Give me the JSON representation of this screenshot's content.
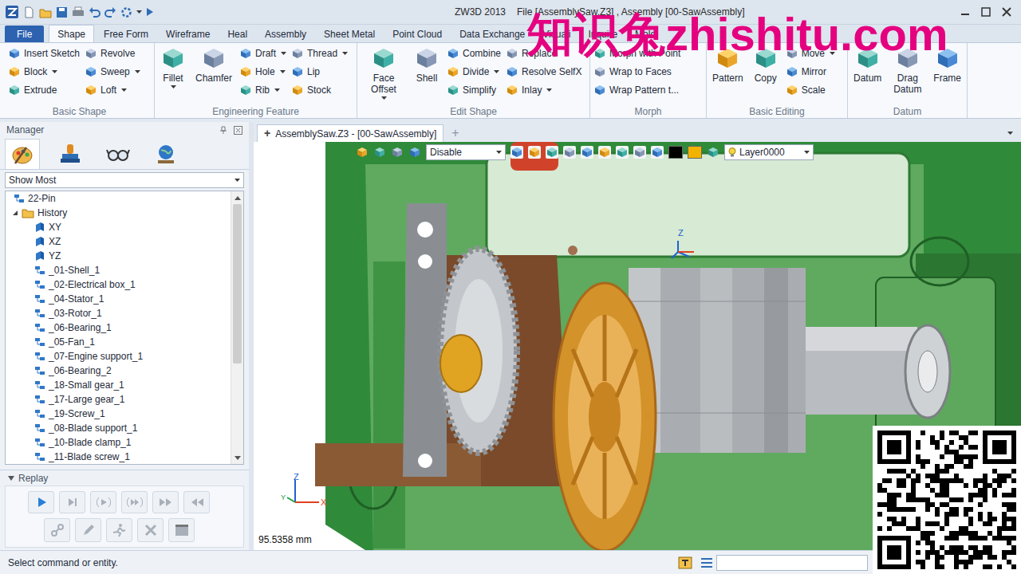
{
  "window": {
    "title": "ZW3D 2013",
    "file_title": "File [AssemblySaw.Z3] , Assembly [00-SawAssembly]"
  },
  "ribbon_tabs": [
    {
      "label": "File",
      "selected": false,
      "kind": "file"
    },
    {
      "label": "Shape",
      "selected": true,
      "kind": "tab"
    },
    {
      "label": "Free Form",
      "selected": false,
      "kind": "tab"
    },
    {
      "label": "Wireframe",
      "selected": false,
      "kind": "tab"
    },
    {
      "label": "Heal",
      "selected": false,
      "kind": "tab"
    },
    {
      "label": "Assembly",
      "selected": false,
      "kind": "tab"
    },
    {
      "label": "Sheet Metal",
      "selected": false,
      "kind": "tab"
    },
    {
      "label": "Point Cloud",
      "selected": false,
      "kind": "tab"
    },
    {
      "label": "Data Exchange",
      "selected": false,
      "kind": "tab"
    },
    {
      "label": "Visuali",
      "selected": false,
      "kind": "tab"
    },
    {
      "label": "Inquire",
      "selected": false,
      "kind": "tab"
    },
    {
      "label": "Mold",
      "selected": false,
      "kind": "tab"
    }
  ],
  "ribbon": {
    "groups": [
      {
        "title": "Basic Shape",
        "large": [],
        "columns": [
          [
            {
              "label": "Insert Sketch",
              "dropdown": false
            },
            {
              "label": "Block",
              "dropdown": true
            },
            {
              "label": "Extrude",
              "dropdown": false
            }
          ],
          [
            {
              "label": "Revolve",
              "dropdown": false
            },
            {
              "label": "Sweep",
              "dropdown": true
            },
            {
              "label": "Loft",
              "dropdown": true
            }
          ]
        ]
      },
      {
        "title": "Engineering Feature",
        "large": [
          {
            "label": "Fillet",
            "dropdown": true
          },
          {
            "label": "Chamfer",
            "dropdown": false
          }
        ],
        "columns": [
          [
            {
              "label": "Draft",
              "dropdown": true
            },
            {
              "label": "Hole",
              "dropdown": true
            },
            {
              "label": "Rib",
              "dropdown": true
            }
          ],
          [
            {
              "label": "Thread",
              "dropdown": true
            },
            {
              "label": "Lip",
              "dropdown": false
            },
            {
              "label": "Stock",
              "dropdown": false
            }
          ]
        ]
      },
      {
        "title": "Edit Shape",
        "large": [
          {
            "label": "Face Offset",
            "dropdown": true
          },
          {
            "label": "Shell",
            "dropdown": false
          }
        ],
        "columns": [
          [
            {
              "label": "Combine",
              "dropdown": false
            },
            {
              "label": "Divide",
              "dropdown": true
            },
            {
              "label": "Simplify",
              "dropdown": false
            }
          ],
          [
            {
              "label": "Replace",
              "dropdown": false
            },
            {
              "label": "Resolve SelfX",
              "dropdown": false
            },
            {
              "label": "Inlay",
              "dropdown": true
            }
          ]
        ]
      },
      {
        "title": "Morph",
        "large": [],
        "columns": [
          [
            {
              "label": "Morph with Point",
              "dropdown": false
            },
            {
              "label": "Wrap to Faces",
              "dropdown": false
            },
            {
              "label": "Wrap Pattern t...",
              "dropdown": false
            }
          ]
        ]
      },
      {
        "title": "Basic Editing",
        "large": [
          {
            "label": "Pattern",
            "dropdown": false
          },
          {
            "label": "Copy",
            "dropdown": false
          }
        ],
        "columns": [
          [
            {
              "label": "Move",
              "dropdown": true
            },
            {
              "label": "Mirror",
              "dropdown": false
            },
            {
              "label": "Scale",
              "dropdown": false
            }
          ]
        ]
      },
      {
        "title": "Datum",
        "large": [
          {
            "label": "Datum",
            "dropdown": false
          },
          {
            "label": "Drag Datum",
            "dropdown": false
          },
          {
            "label": "Frame",
            "dropdown": false
          }
        ],
        "columns": []
      }
    ]
  },
  "manager": {
    "title": "Manager",
    "tabs": [
      {
        "kind": "palette",
        "selected": true
      },
      {
        "kind": "stamp",
        "selected": false
      },
      {
        "kind": "glasses",
        "selected": false
      },
      {
        "kind": "globe",
        "selected": false
      }
    ],
    "filter": "Show Most",
    "tree": [
      {
        "label": "22-Pin",
        "depth": 0,
        "kind": "assembly"
      },
      {
        "label": "History",
        "depth": 1,
        "kind": "folder",
        "expanded": true
      },
      {
        "label": "XY",
        "depth": 2,
        "kind": "plane"
      },
      {
        "label": "XZ",
        "depth": 2,
        "kind": "plane"
      },
      {
        "label": "YZ",
        "depth": 2,
        "kind": "plane"
      },
      {
        "label": "_01-Shell_1",
        "depth": 2,
        "kind": "assembly"
      },
      {
        "label": "_02-Electrical box_1",
        "depth": 2,
        "kind": "assembly"
      },
      {
        "label": "_04-Stator_1",
        "depth": 2,
        "kind": "assembly"
      },
      {
        "label": "_03-Rotor_1",
        "depth": 2,
        "kind": "assembly"
      },
      {
        "label": "_06-Bearing_1",
        "depth": 2,
        "kind": "assembly"
      },
      {
        "label": "_05-Fan_1",
        "depth": 2,
        "kind": "assembly"
      },
      {
        "label": "_07-Engine support_1",
        "depth": 2,
        "kind": "assembly"
      },
      {
        "label": "_06-Bearing_2",
        "depth": 2,
        "kind": "assembly"
      },
      {
        "label": "_18-Small gear_1",
        "depth": 2,
        "kind": "assembly"
      },
      {
        "label": "_17-Large gear_1",
        "depth": 2,
        "kind": "assembly"
      },
      {
        "label": "_19-Screw_1",
        "depth": 2,
        "kind": "assembly"
      },
      {
        "label": "_08-Blade support_1",
        "depth": 2,
        "kind": "assembly"
      },
      {
        "label": "_10-Blade clamp_1",
        "depth": 2,
        "kind": "assembly"
      },
      {
        "label": "_11-Blade screw_1",
        "depth": 2,
        "kind": "assembly"
      }
    ],
    "replay": {
      "title": "Replay",
      "expanded": true,
      "rows": [
        [
          {
            "kind": "play",
            "disabled": false
          },
          {
            "kind": "next",
            "disabled": true
          },
          {
            "kind": "step",
            "disabled": true
          },
          {
            "kind": "step-over",
            "disabled": true
          },
          {
            "kind": "forward",
            "disabled": true
          },
          {
            "kind": "rewind",
            "disabled": true
          }
        ],
        [
          {
            "kind": "link",
            "disabled": true
          },
          {
            "kind": "pencil",
            "disabled": true
          },
          {
            "kind": "run",
            "disabled": true
          },
          {
            "kind": "delete",
            "disabled": true
          },
          {
            "kind": "window",
            "disabled": true
          }
        ]
      ]
    }
  },
  "document_tabs": {
    "marker": "+",
    "label": "AssemblySaw.Z3 - [00-SawAssembly]",
    "add": "+"
  },
  "viewport_toolbar": {
    "filter": "Disable",
    "colors": [
      "#000000",
      "#f2b200"
    ],
    "layer": "Layer0000"
  },
  "viewport": {
    "scale": "95.5358 mm",
    "triad": {
      "z": "Z",
      "x": "X",
      "y": "Y"
    },
    "center_triad": "Z"
  },
  "status_bar": {
    "message": "Select command or entity."
  },
  "watermark": "知识兔zhishitu.com"
}
